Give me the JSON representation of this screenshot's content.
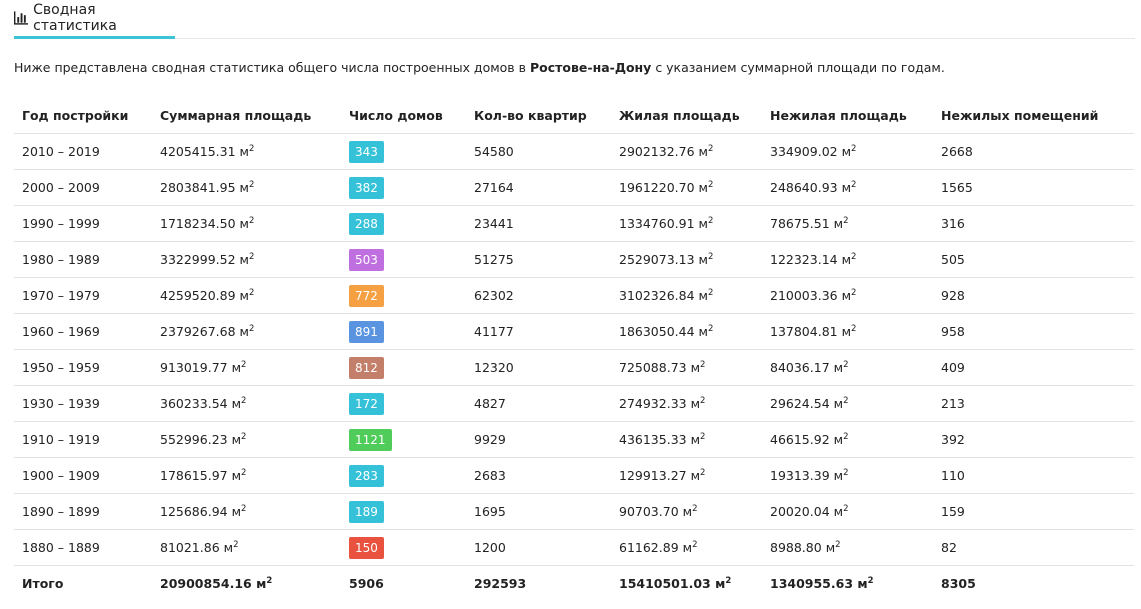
{
  "tab": {
    "label": "Сводная статистика",
    "icon": "bar-chart-icon"
  },
  "intro": {
    "before": "Ниже представлена сводная статистика общего числа построенных домов в ",
    "city": "Ростове-на-Дону",
    "after": " с указанием суммарной площади по годам."
  },
  "unit": "м",
  "unit_sup": "2",
  "headers": [
    "Год постройки",
    "Суммарная площадь",
    "Число домов",
    "Кол-во квартир",
    "Жилая площадь",
    "Нежилая площадь",
    "Нежилых помещений"
  ],
  "rows": [
    {
      "period": "2010 – 2019",
      "total_area": "4205415.31",
      "houses": "343",
      "color": "#35c2d8",
      "flats": "54580",
      "living": "2902132.76",
      "nonliving": "334909.02",
      "premises": "2668"
    },
    {
      "period": "2000 – 2009",
      "total_area": "2803841.95",
      "houses": "382",
      "color": "#35c2d8",
      "flats": "27164",
      "living": "1961220.70",
      "nonliving": "248640.93",
      "premises": "1565"
    },
    {
      "period": "1990 – 1999",
      "total_area": "1718234.50",
      "houses": "288",
      "color": "#35c2d8",
      "flats": "23441",
      "living": "1334760.91",
      "nonliving": "78675.51",
      "premises": "316"
    },
    {
      "period": "1980 – 1989",
      "total_area": "3322999.52",
      "houses": "503",
      "color": "#c06fe0",
      "flats": "51275",
      "living": "2529073.13",
      "nonliving": "122323.14",
      "premises": "505"
    },
    {
      "period": "1970 – 1979",
      "total_area": "4259520.89",
      "houses": "772",
      "color": "#f5a043",
      "flats": "62302",
      "living": "3102326.84",
      "nonliving": "210003.36",
      "premises": "928"
    },
    {
      "period": "1960 – 1969",
      "total_area": "2379267.68",
      "houses": "891",
      "color": "#5a94e0",
      "flats": "41177",
      "living": "1863050.44",
      "nonliving": "137804.81",
      "premises": "958"
    },
    {
      "period": "1950 – 1959",
      "total_area": "913019.77",
      "houses": "812",
      "color": "#c47f6a",
      "flats": "12320",
      "living": "725088.73",
      "nonliving": "84036.17",
      "premises": "409"
    },
    {
      "period": "1930 – 1939",
      "total_area": "360233.54",
      "houses": "172",
      "color": "#35c2d8",
      "flats": "4827",
      "living": "274932.33",
      "nonliving": "29624.54",
      "premises": "213"
    },
    {
      "period": "1910 – 1919",
      "total_area": "552996.23",
      "houses": "1121",
      "color": "#4fcc5a",
      "flats": "9929",
      "living": "436135.33",
      "nonliving": "46615.92",
      "premises": "392"
    },
    {
      "period": "1900 – 1909",
      "total_area": "178615.97",
      "houses": "283",
      "color": "#35c2d8",
      "flats": "2683",
      "living": "129913.27",
      "nonliving": "19313.39",
      "premises": "110"
    },
    {
      "period": "1890 – 1899",
      "total_area": "125686.94",
      "houses": "189",
      "color": "#35c2d8",
      "flats": "1695",
      "living": "90703.70",
      "nonliving": "20020.04",
      "premises": "159"
    },
    {
      "period": "1880 – 1889",
      "total_area": "81021.86",
      "houses": "150",
      "color": "#e8523f",
      "flats": "1200",
      "living": "61162.89",
      "nonliving": "8988.80",
      "premises": "82"
    }
  ],
  "total": {
    "label": "Итого",
    "total_area": "20900854.16",
    "houses": "5906",
    "flats": "292593",
    "living": "15410501.03",
    "nonliving": "1340955.63",
    "premises": "8305"
  }
}
